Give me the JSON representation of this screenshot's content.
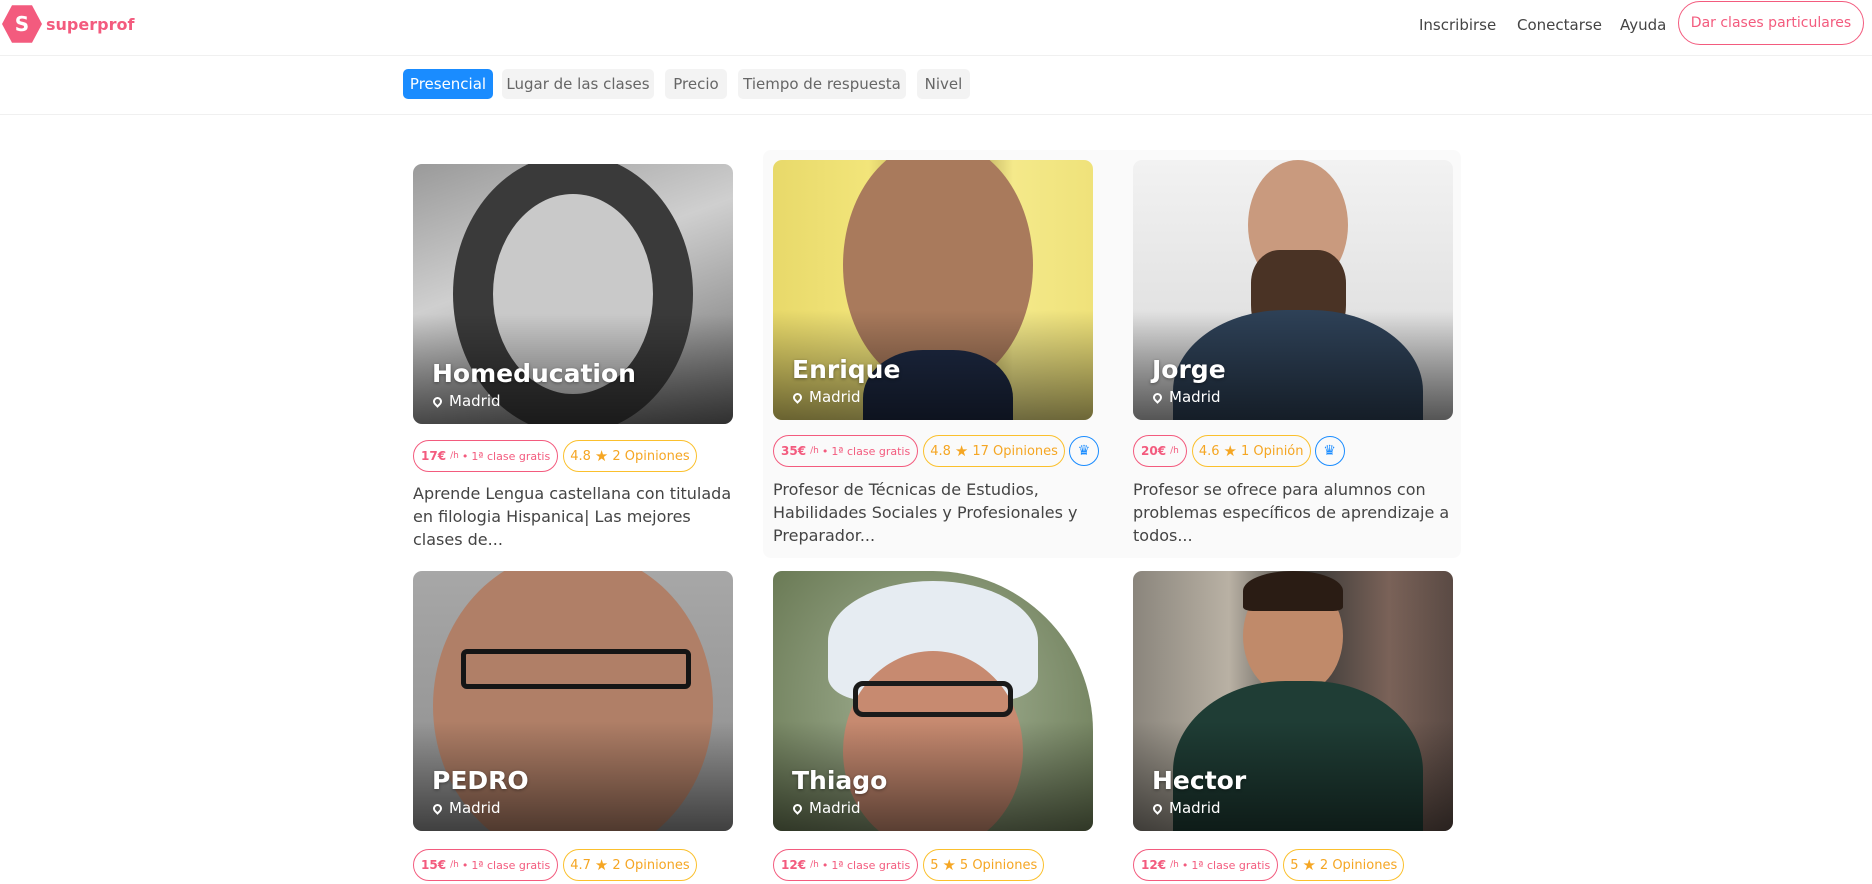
{
  "brand": {
    "logo_letter": "S",
    "name": "superprof",
    "color": "#f35b7e"
  },
  "nav": {
    "signup": "Inscribirse",
    "login": "Conectarse",
    "help": "Ayuda",
    "teach": "Dar clases particulares"
  },
  "filters": [
    "Presencial",
    "Lugar de las clases",
    "Precio",
    "Tiempo de respuesta",
    "Nivel"
  ],
  "accent_color": "#1a8cff",
  "teachers": [
    {
      "name": "Homeducation",
      "location": "Madrid",
      "price": "17€",
      "unit": "/h",
      "free_class": "1ª clase gratis",
      "rating": "4.8",
      "reviews": "2 Opiniones",
      "ambassador": false,
      "description": "Aprende Lengua castellana con titulada en filologia Hispanica| Las mejores clases de..."
    },
    {
      "name": "Enrique",
      "location": "Madrid",
      "price": "35€",
      "unit": "/h",
      "free_class": "1ª clase gratis",
      "rating": "4.8",
      "reviews": "17 Opiniones",
      "ambassador": true,
      "description": "Profesor de Técnicas de Estudios, Habilidades Sociales y Profesionales y Preparador..."
    },
    {
      "name": "Jorge",
      "location": "Madrid",
      "price": "20€",
      "unit": "/h",
      "free_class": "",
      "rating": "4.6",
      "reviews": "1 Opinión",
      "ambassador": true,
      "description": "Profesor se ofrece para alumnos con problemas específicos de aprendizaje a todos..."
    },
    {
      "name": "PEDRO",
      "location": "Madrid",
      "price": "15€",
      "unit": "/h",
      "free_class": "1ª clase gratis",
      "rating": "4.7",
      "reviews": "2 Opiniones",
      "ambassador": false,
      "description": ""
    },
    {
      "name": "Thiago",
      "location": "Madrid",
      "price": "12€",
      "unit": "/h",
      "free_class": "1ª clase gratis",
      "rating": "5",
      "reviews": "5 Opiniones",
      "ambassador": false,
      "description": ""
    },
    {
      "name": "Hector",
      "location": "Madrid",
      "price": "12€",
      "unit": "/h",
      "free_class": "1ª clase gratis",
      "rating": "5",
      "reviews": "2 Opiniones",
      "ambassador": false,
      "description": ""
    }
  ],
  "icons": {
    "location": "map-pin-icon",
    "rating": "star-icon",
    "ambassador": "crown-icon"
  }
}
